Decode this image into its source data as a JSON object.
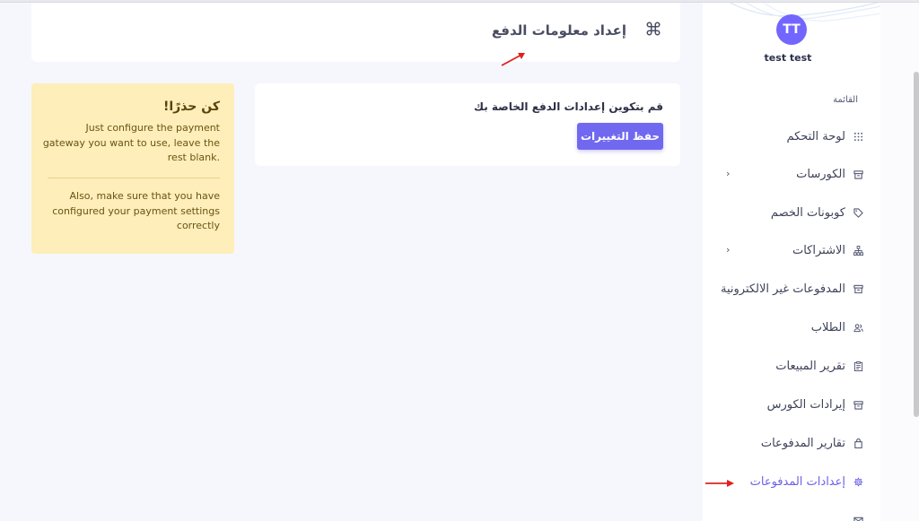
{
  "user": {
    "initials": "TT",
    "name": "test test"
  },
  "sidebar": {
    "header": "القائمة",
    "items": [
      {
        "label": "لوحة التحكم",
        "icon": "grid-icon",
        "has_chevron": false
      },
      {
        "label": "الكورسات",
        "icon": "box-icon",
        "has_chevron": true
      },
      {
        "label": "كوبونات الخصم",
        "icon": "tag-icon",
        "has_chevron": false
      },
      {
        "label": "الاشتراكات",
        "icon": "sitemap-icon",
        "has_chevron": true
      },
      {
        "label": "المدفوعات غير الالكترونية",
        "icon": "archive-icon",
        "has_chevron": false
      },
      {
        "label": "الطلاب",
        "icon": "users-icon",
        "has_chevron": false
      },
      {
        "label": "تقرير المبيعات",
        "icon": "clipboard-icon",
        "has_chevron": false
      },
      {
        "label": "إيرادات الكورس",
        "icon": "box-icon",
        "has_chevron": false
      },
      {
        "label": "تقارير المدفوعات",
        "icon": "bag-icon",
        "has_chevron": false
      },
      {
        "label": "إعدادات المدفوعات",
        "icon": "gear-icon",
        "has_chevron": false,
        "active": true
      }
    ]
  },
  "page": {
    "title": "إعداد معلومات الدفع",
    "instruction": "قم بتكوين إعدادات الدفع الخاصة بك",
    "save_label": "حفظ التغييرات"
  },
  "warning": {
    "title": "كن حذرًا!",
    "text1": "Just configure the payment gateway you want to use, leave the rest blank.",
    "text2": "Also, make sure that you have configured your payment settings correctly"
  },
  "colors": {
    "accent": "#7168f0",
    "warning_bg": "#fdeeba",
    "arrow": "#e02020"
  }
}
